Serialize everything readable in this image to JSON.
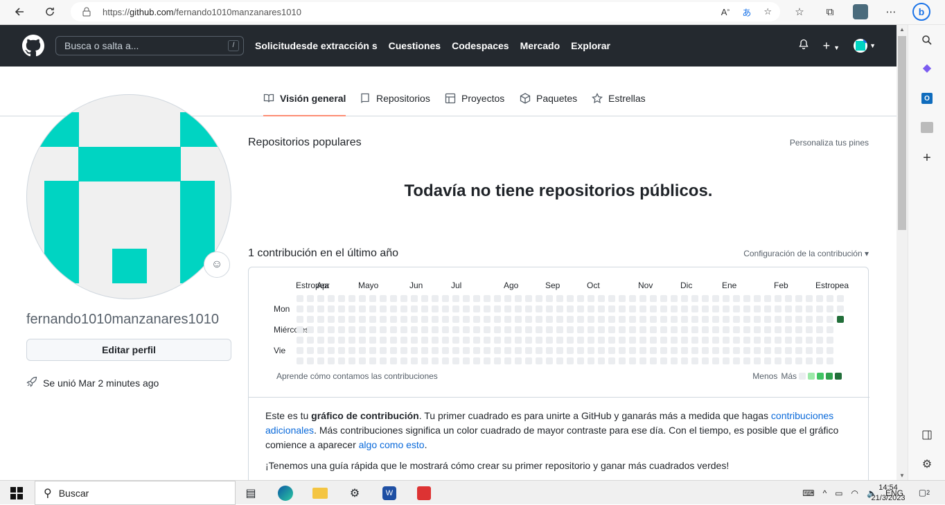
{
  "browser": {
    "url_prefix": "https://",
    "url_host": "github.com",
    "url_path": "/fernando1010manzanares1010"
  },
  "header": {
    "search_placeholder": "Busca o salta a...",
    "search_shortcut": "/",
    "nav": [
      "Solicitudesde extracción s",
      "Cuestiones",
      "Codespaces",
      "Mercado",
      "Explorar"
    ]
  },
  "tabs": [
    {
      "label": "Visión general",
      "icon": "book-icon",
      "active": true
    },
    {
      "label": "Repositorios",
      "icon": "repo-icon",
      "active": false
    },
    {
      "label": "Proyectos",
      "icon": "table-icon",
      "active": false
    },
    {
      "label": "Paquetes",
      "icon": "package-icon",
      "active": false
    },
    {
      "label": "Estrellas",
      "icon": "star-icon",
      "active": false
    }
  ],
  "profile": {
    "username": "fernando1010manzanares1010",
    "edit_label": "Editar perfil",
    "joined": "Se unió Mar 2 minutes ago",
    "avatar_color": "#00d4c2"
  },
  "pinned": {
    "title": "Repositorios populares",
    "customize": "Personaliza tus pines",
    "empty": "Todavía no tiene repositorios públicos."
  },
  "contributions": {
    "title": "1 contribución en el último año",
    "settings": "Configuración de la contribución",
    "months": [
      "Estropea",
      "Apr",
      "Mayo",
      "Jun",
      "Jul",
      "Ago",
      "Sep",
      "Oct",
      "Nov",
      "Dic",
      "Ene",
      "Feb",
      "Estropea"
    ],
    "days": [
      "Mon",
      "Miércoles",
      "Vie"
    ],
    "learn": "Aprende cómo contamos las contribuciones",
    "less": "Menos",
    "more": "Más",
    "count": 1,
    "colors": [
      "#ebedf0",
      "#9be9a8",
      "#40c463",
      "#30a14e",
      "#216e39"
    ],
    "explain_1": "Este es tu ",
    "explain_bold": "gráfico de contribución",
    "explain_2": ". Tu primer cuadrado es para unirte a GitHub y ganarás más a medida que hagas ",
    "explain_link1": "contribuciones adicionales",
    "explain_3": ". Más contribuciones significa un color cuadrado de mayor contraste para ese día. Con el tiempo, es posible que el gráfico comience a aparecer ",
    "explain_link2": "algo como esto",
    "explain_4": ".",
    "guide": "¡Tenemos una guía rápida que le mostrará cómo crear su primer repositorio y ganar más cuadrados verdes!"
  },
  "taskbar": {
    "search": "Buscar",
    "lang": "ENG",
    "time": "14:54",
    "date": "21/3/2023",
    "notifications": "2"
  }
}
